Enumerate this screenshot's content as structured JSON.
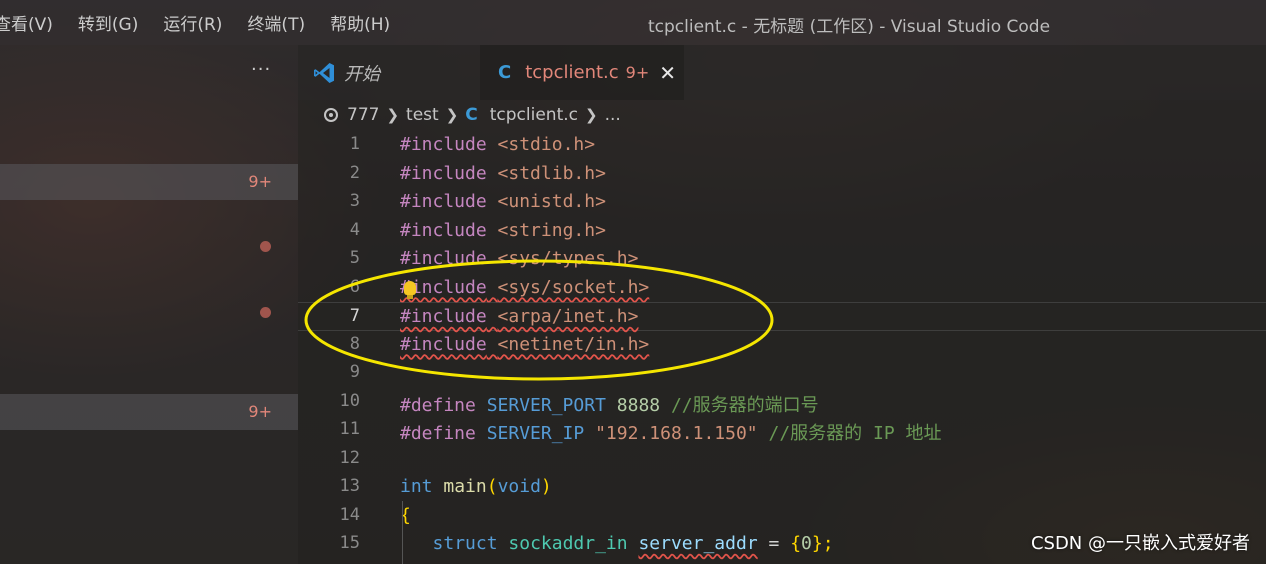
{
  "menu": [
    "查看(V)",
    "转到(G)",
    "运行(R)",
    "终端(T)",
    "帮助(H)"
  ],
  "window_title": "tcpclient.c - 无标题 (工作区) - Visual Studio Code",
  "sidebar": {
    "more": "···",
    "badges": [
      "9+",
      "9+"
    ]
  },
  "tabs": {
    "start_label": "开始",
    "active_icon": "C",
    "active_label": "tcpclient.c",
    "active_badge": "9+",
    "close": "✕"
  },
  "breadcrumb": {
    "items": [
      "777",
      "test",
      "tcpclient.c",
      "..."
    ],
    "file_icon": "C"
  },
  "code_lines": [
    {
      "n": "1"
    },
    {
      "n": "2"
    },
    {
      "n": "3"
    },
    {
      "n": "4"
    },
    {
      "n": "5"
    },
    {
      "n": "6"
    },
    {
      "n": "7"
    },
    {
      "n": "8"
    },
    {
      "n": "9"
    },
    {
      "n": "10"
    },
    {
      "n": "11"
    },
    {
      "n": "12"
    },
    {
      "n": "13"
    },
    {
      "n": "14"
    },
    {
      "n": "15"
    }
  ],
  "code": {
    "include": "#include",
    "define": "#define",
    "h1": "<stdio.h>",
    "h2": "<stdlib.h>",
    "h3": "<unistd.h>",
    "h4": "<string.h>",
    "h5": "<sys/types.h>",
    "h6": "<sys/socket.h>",
    "h7": "<arpa/inet.h>",
    "h8": "<netinet/in.h>",
    "port_macro": "SERVER_PORT",
    "port_value": "8888",
    "port_comment": "//服务器的端口号",
    "ip_macro": "SERVER_IP",
    "ip_value": "\"192.168.1.150\"",
    "ip_comment": "//服务器的 IP 地址",
    "int_kw": "int",
    "main_fn": "main",
    "lparen": "(",
    "void_kw": "void",
    "rparen": ")",
    "lbrace": "{",
    "struct_kw": "struct",
    "sockaddr_type": "sockaddr_in",
    "server_addr": "server_addr",
    "assign": " = ",
    "init_open": "{",
    "zero": "0",
    "init_close": "};"
  },
  "watermark": "CSDN @一只嵌入式爱好者",
  "colors": {
    "annotation_circle": "#f5e600",
    "error_badge": "#e2877a",
    "c_icon": "#3c9ad6",
    "vscode_icon": "#2f8fd8"
  }
}
